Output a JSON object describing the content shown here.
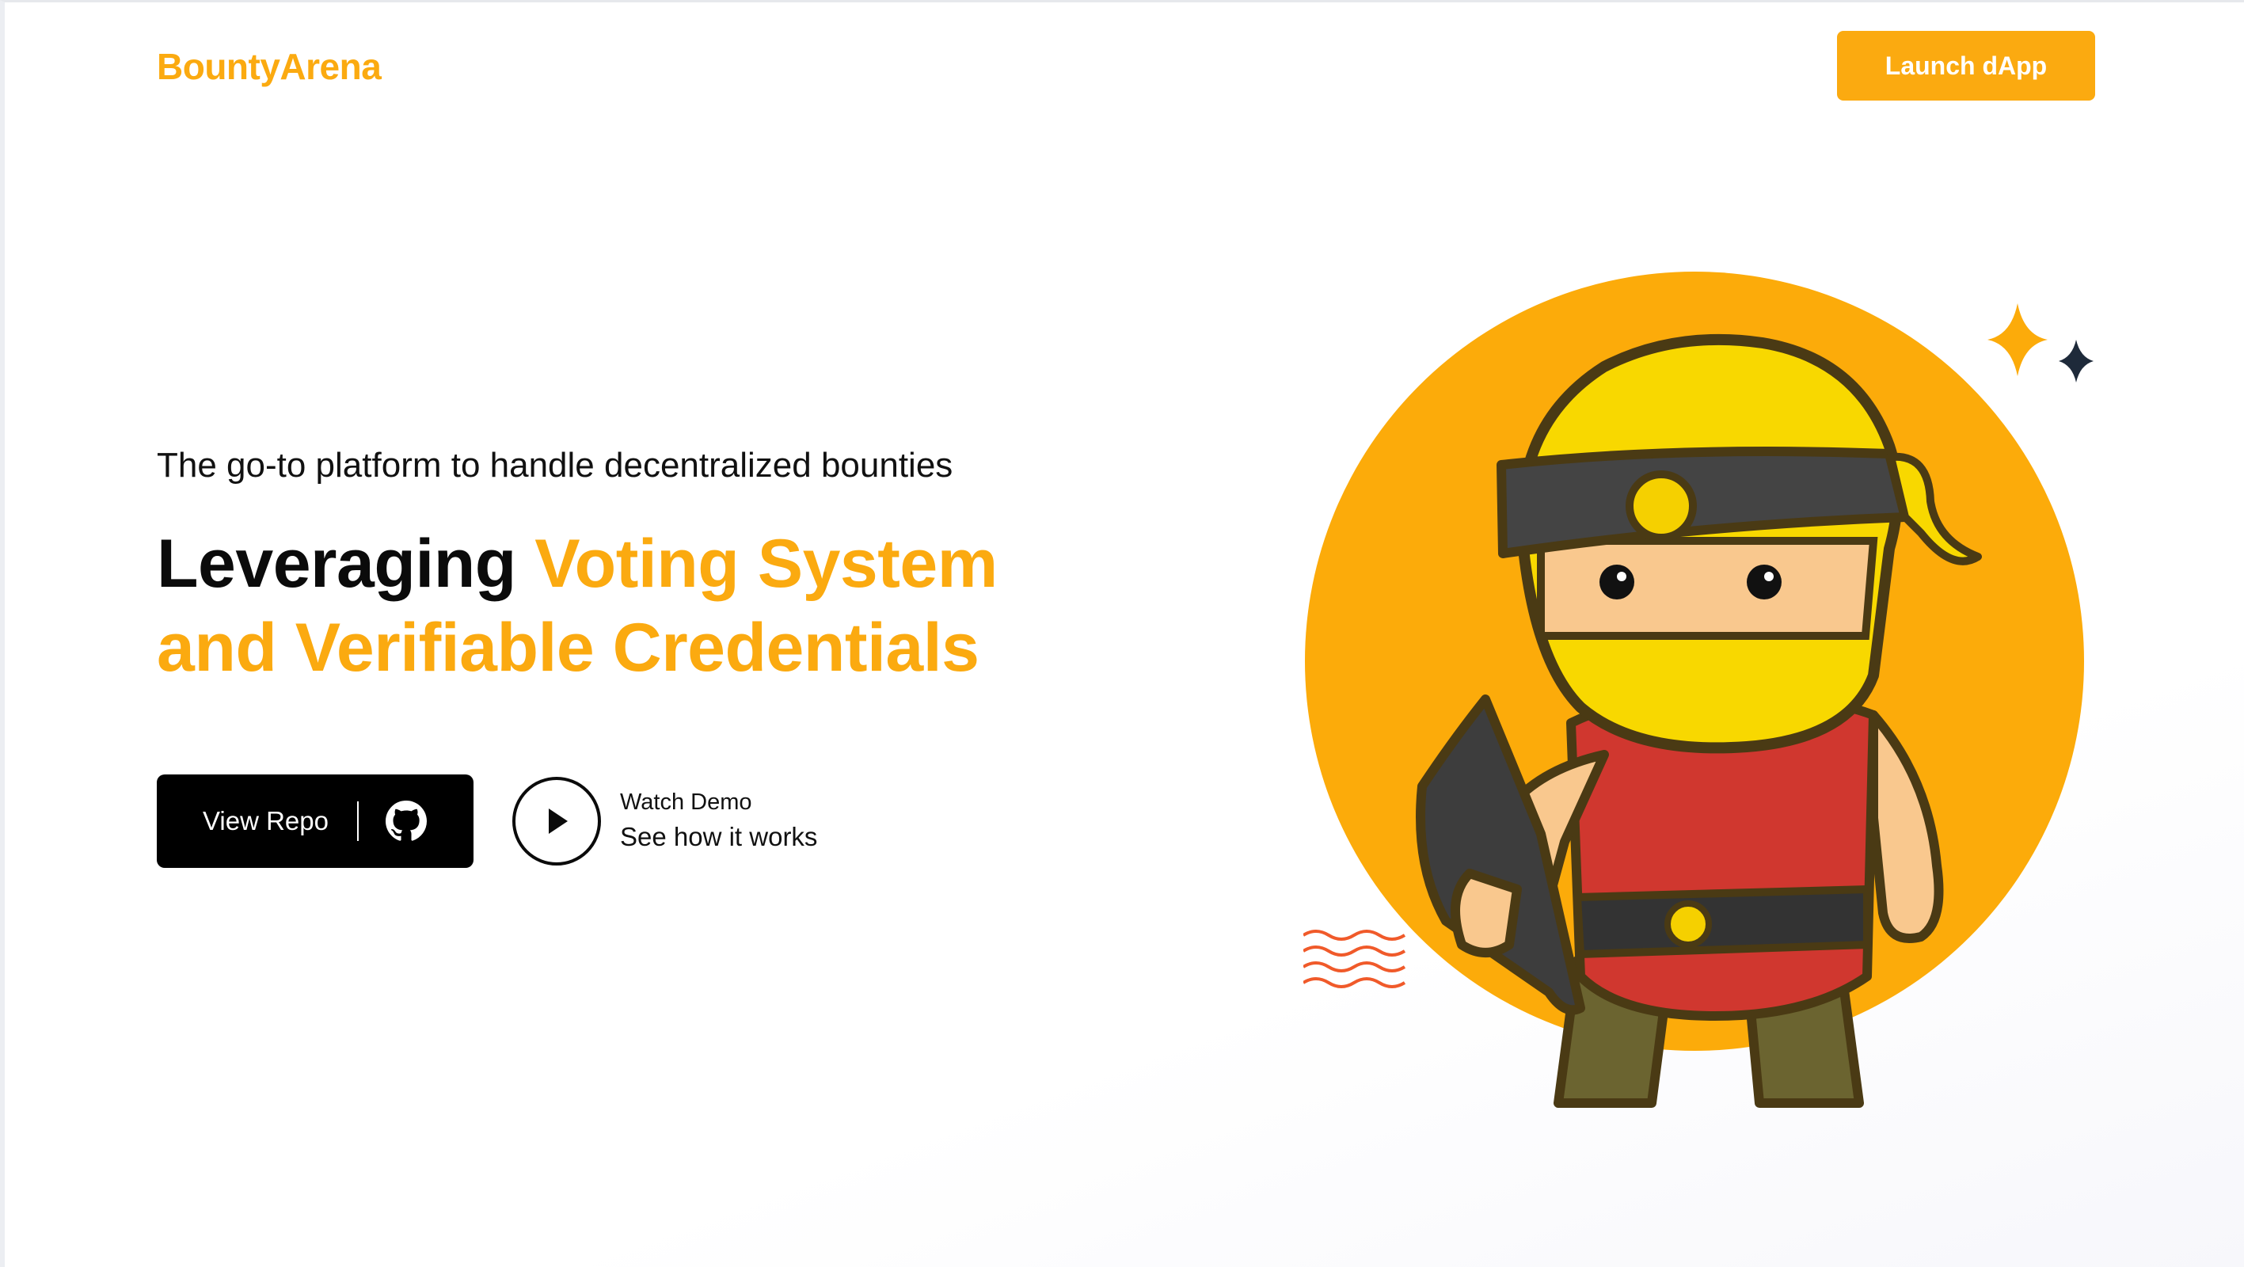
{
  "header": {
    "brand": "BountyArena",
    "launch_label": "Launch dApp"
  },
  "hero": {
    "tagline": "The go-to platform to handle decentralized bounties",
    "headline_plain": "Leveraging ",
    "headline_accent_1": "Voting System",
    "headline_accent_2": "and Verifiable Credentials"
  },
  "actions": {
    "view_repo_label": "View Repo",
    "view_repo_icon": "github-icon",
    "demo_icon": "play-icon",
    "demo_title": "Watch Demo",
    "demo_subtitle": "See how it works"
  },
  "illustration": {
    "subject": "ninja-mascot",
    "decorations": [
      "orange-star-icon",
      "dark-star-icon",
      "wavy-lines"
    ]
  },
  "colors": {
    "accent": "#fbaa10",
    "dark": "#000000",
    "background": "#ffffff"
  }
}
